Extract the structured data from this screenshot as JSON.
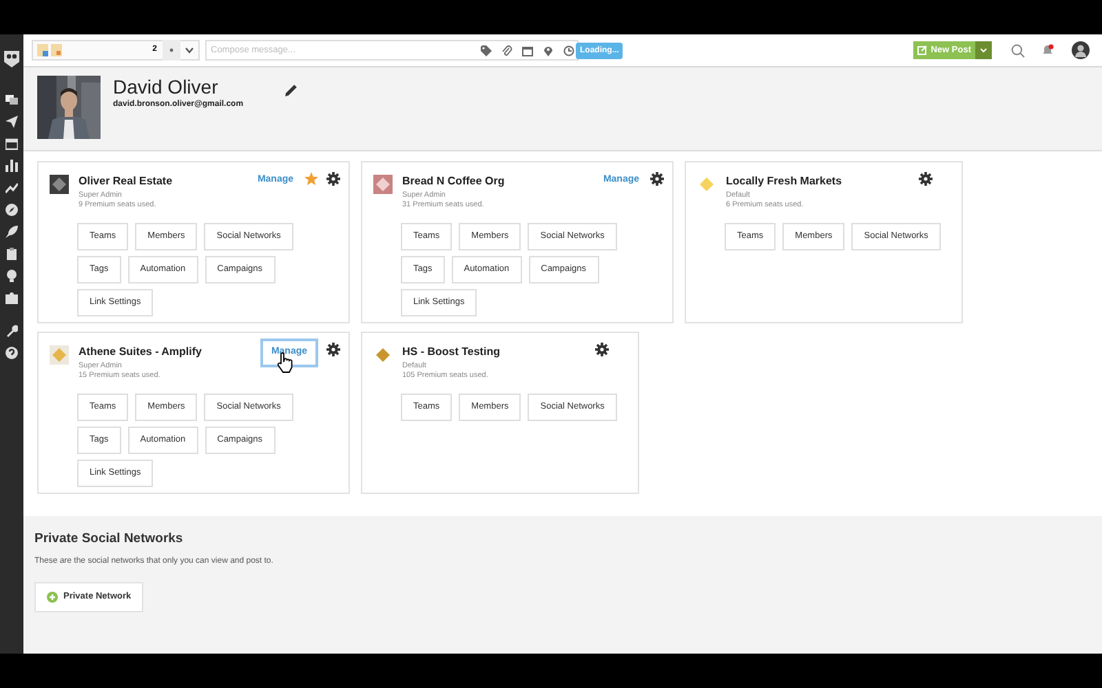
{
  "toolbar": {
    "account_count": "2",
    "compose": {
      "placeholder": "Compose message..."
    },
    "loading_badge": "Loading...",
    "new_post": "New Post",
    "notifications_unread": true
  },
  "profile": {
    "name": "David Oliver",
    "email": "david.bronson.oliver@gmail.com"
  },
  "organizations": [
    {
      "name": "Oliver Real Estate",
      "role": "Super Admin",
      "seats": "9 Premium seats used.",
      "manage": "Manage",
      "manage_focused": false,
      "favorite": true,
      "buttons": [
        "Teams",
        "Members",
        "Social Networks",
        "Tags",
        "Automation",
        "Campaigns",
        "Link Settings"
      ]
    },
    {
      "name": "Bread N Coffee Org",
      "role": "Super Admin",
      "seats": "31 Premium seats used.",
      "manage": "Manage",
      "manage_focused": false,
      "favorite": false,
      "buttons": [
        "Teams",
        "Members",
        "Social Networks",
        "Tags",
        "Automation",
        "Campaigns",
        "Link Settings"
      ]
    },
    {
      "name": "Locally Fresh Markets",
      "role": "Default",
      "seats": "6 Premium seats used.",
      "favorite": false,
      "buttons": [
        "Teams",
        "Members",
        "Social Networks"
      ]
    },
    {
      "name": "Athene Suites - Amplify",
      "role": "Super Admin",
      "seats": "15 Premium seats used.",
      "manage": "Manage",
      "manage_focused": true,
      "favorite": false,
      "buttons": [
        "Teams",
        "Members",
        "Social Networks",
        "Tags",
        "Automation",
        "Campaigns",
        "Link Settings"
      ]
    },
    {
      "name": "HS - Boost Testing",
      "role": "Default",
      "seats": "105 Premium seats used.",
      "favorite": false,
      "buttons": [
        "Teams",
        "Members",
        "Social Networks"
      ]
    }
  ],
  "private_networks": {
    "title": "Private Social Networks",
    "description": "These are the social networks that only you can view and post to.",
    "button": "Private Network"
  }
}
